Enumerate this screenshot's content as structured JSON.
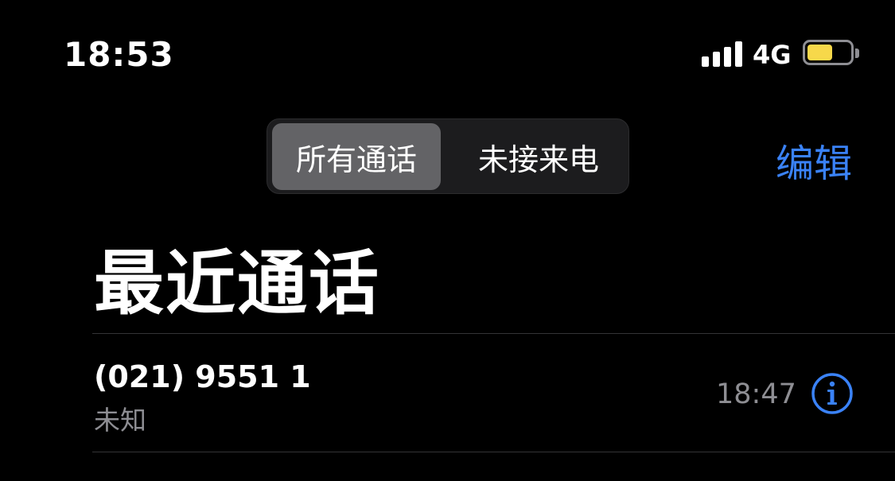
{
  "status_bar": {
    "time": "18:53",
    "network": "4G",
    "signal_bars": 4,
    "battery_level": 0.6
  },
  "header": {
    "segments": [
      {
        "label": "所有通话",
        "selected": true
      },
      {
        "label": "未接来电",
        "selected": false
      }
    ],
    "edit_label": "编辑"
  },
  "page": {
    "title": "最近通话"
  },
  "calls": [
    {
      "number": "(021) 9551 1",
      "label": "未知",
      "time": "18:47",
      "info_icon": "info-circle-icon"
    }
  ],
  "colors": {
    "background": "#000000",
    "accent": "#3a82f7",
    "secondary_text": "#8e8e93",
    "segment_selected": "#636366",
    "battery": "#f7d84a"
  }
}
